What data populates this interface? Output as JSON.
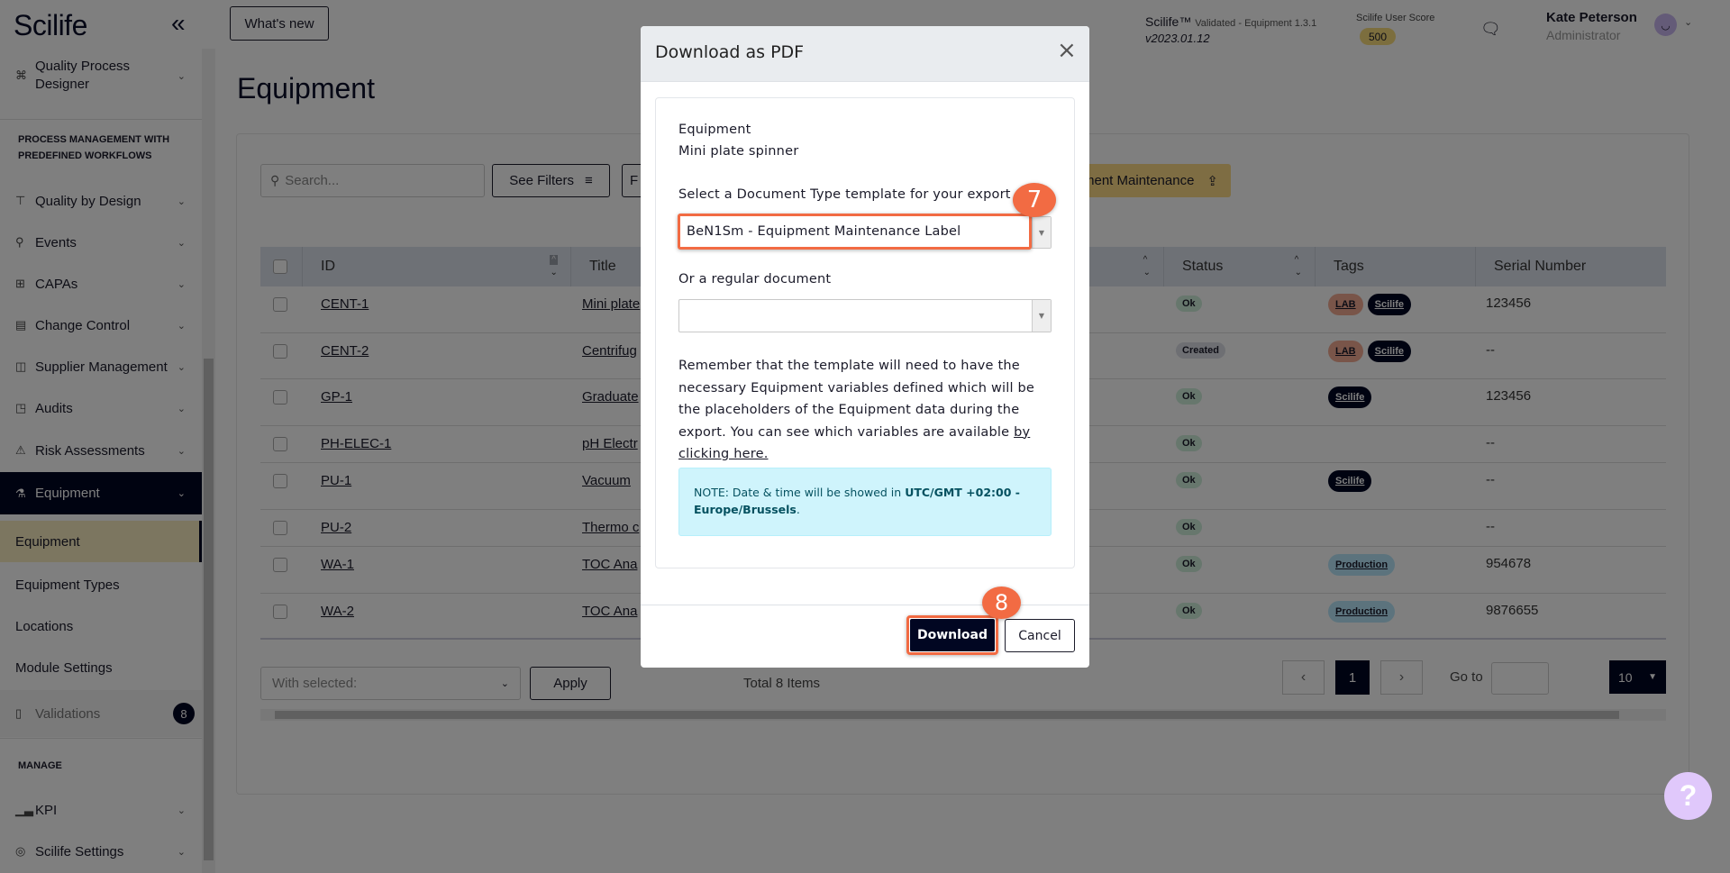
{
  "brand": {
    "logo": "Scilife",
    "collapse_icon": "double-chevron-left-icon"
  },
  "header": {
    "whats_new": "What's new",
    "product": "Scilife™",
    "validated": "Validated - Equipment 1.3.1",
    "version": "v2023.01.12",
    "score_label": "Scilife User Score",
    "score": "500",
    "user_name": "Kate Peterson",
    "user_role": "Administrator"
  },
  "sidebar": {
    "items": [
      {
        "label": "Quality Process",
        "label2": "Designer",
        "icon": "workflow-icon"
      },
      {
        "label": "Quality by Design",
        "icon": "signpost-icon"
      },
      {
        "label": "Events",
        "icon": "pin-icon"
      },
      {
        "label": "CAPAs",
        "icon": "capa-icon"
      },
      {
        "label": "Change Control",
        "icon": "document-icon"
      },
      {
        "label": "Supplier Management",
        "icon": "box-icon"
      },
      {
        "label": "Audits",
        "icon": "audit-icon"
      },
      {
        "label": "Risk Assessments",
        "icon": "warning-icon"
      },
      {
        "label": "Equipment",
        "icon": "flask-icon"
      }
    ],
    "section_process": "PROCESS MANAGEMENT WITH PREDEFINED WORKFLOWS",
    "sub_items": [
      "Equipment",
      "Equipment Types",
      "Locations",
      "Module Settings"
    ],
    "validations": {
      "label": "Validations",
      "badge": "8"
    },
    "section_manage": "MANAGE",
    "manage_items": [
      {
        "label": "KPI",
        "icon": "chart-icon"
      },
      {
        "label": "Scilife Settings",
        "icon": "settings-icon"
      }
    ]
  },
  "page": {
    "title": "Equipment"
  },
  "toolbar": {
    "search_placeholder": "Search...",
    "see_filters": "See Filters",
    "other_button": "F",
    "maintenance_button": "Equipment Maintenance"
  },
  "table": {
    "columns": [
      "ID",
      "Title",
      "Status",
      "Tags",
      "Serial Number"
    ],
    "rows": [
      {
        "id": "CENT-1",
        "title": "Mini plate",
        "status": "Ok",
        "tags": [
          "LAB",
          "Scilife"
        ],
        "serial": "123456"
      },
      {
        "id": "CENT-2",
        "title": "Centrifug",
        "status": "Created",
        "tags": [
          "LAB",
          "Scilife"
        ],
        "serial": "--"
      },
      {
        "id": "GP-1",
        "title": "Graduate",
        "status": "Ok",
        "tags": [
          "Scilife"
        ],
        "serial": "123456"
      },
      {
        "id": "PH-ELEC-1",
        "title": "pH Electr",
        "status": "Ok",
        "tags": [],
        "serial": "--"
      },
      {
        "id": "PU-1",
        "title": "Vacuum",
        "status": "Ok",
        "tags": [
          "Scilife"
        ],
        "serial": "--"
      },
      {
        "id": "PU-2",
        "title": "Thermo c",
        "status": "Ok",
        "tags": [],
        "serial": "--"
      },
      {
        "id": "WA-1",
        "title": "TOC Ana",
        "status": "Ok",
        "tags": [
          "Production"
        ],
        "serial": "954678"
      },
      {
        "id": "WA-2",
        "title": "TOC Ana",
        "status": "Ok",
        "tags": [
          "Production"
        ],
        "serial": "9876655"
      }
    ]
  },
  "footer": {
    "with_selected": "With selected:",
    "apply": "Apply",
    "total": "Total 8 Items",
    "page": "1",
    "go_to": "Go to",
    "page_size": "10"
  },
  "colors": {
    "navy": "#010622",
    "accent": "#f26b43",
    "ok": "#cfeedb",
    "created": "#dcdfe6",
    "lab": "#f2ab93",
    "production": "#b8e6fb",
    "scilife_tag": "#010622"
  },
  "modal": {
    "title": "Download as PDF",
    "entity": "Equipment",
    "entity_name": "Mini plate spinner",
    "template_label": "Select a Document Type template for your export",
    "template_value": "BeN1Sm - Equipment Maintenance Label",
    "regular_label": "Or a regular document",
    "regular_value": "",
    "info": "Remember that the template will need to have the necessary Equipment variables defined which will be the placeholders of the Equipment data during the export. You can see which variables are available ",
    "info_link": "by clicking here.",
    "note_prefix": "NOTE: Date & time will be showed in ",
    "note_tz": "UTC/GMT +02:00 - Europe/Brussels",
    "download": "Download",
    "cancel": "Cancel",
    "callout_select": "7",
    "callout_download": "8"
  }
}
